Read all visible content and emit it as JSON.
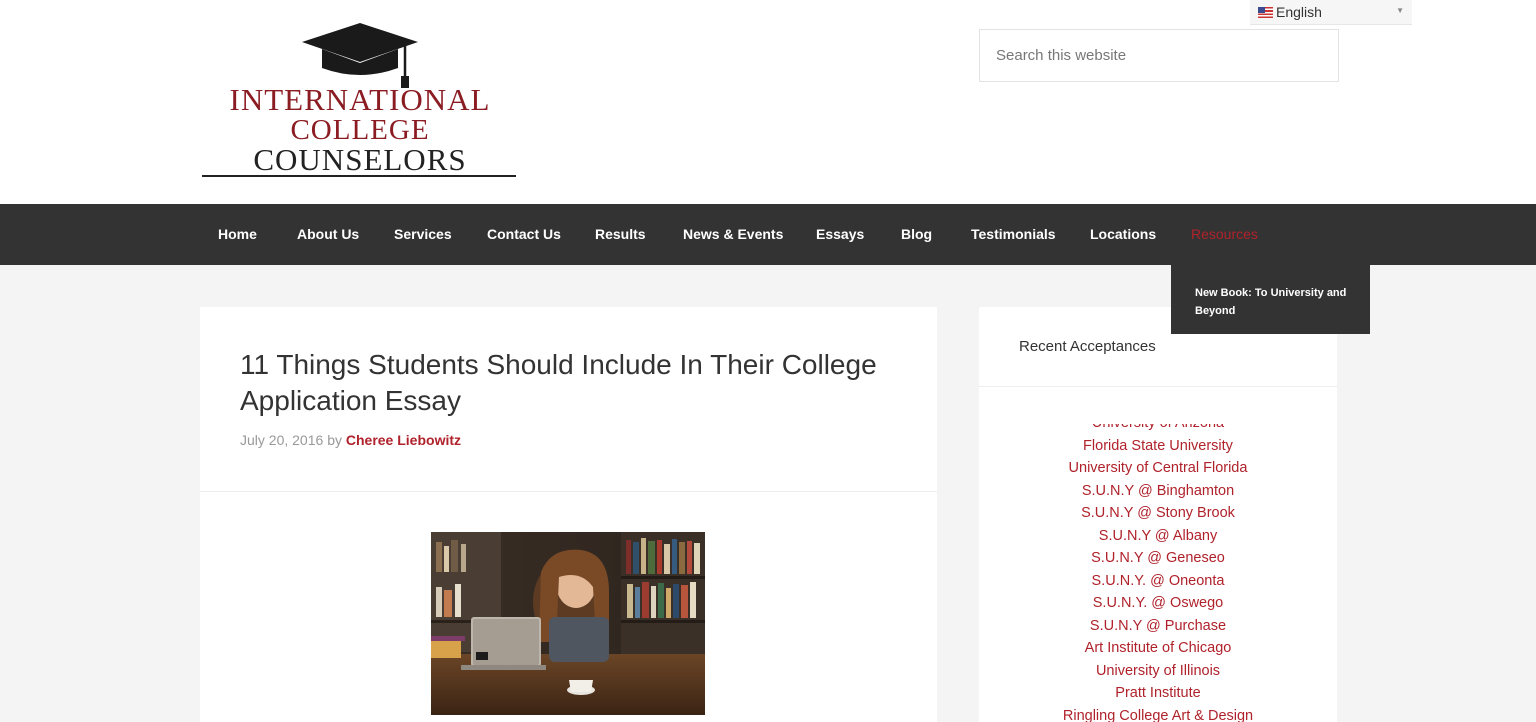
{
  "brand": {
    "logo_line1": "INTERNATIONAL",
    "logo_line2": "COLLEGE",
    "logo_line3": "COUNSELORS",
    "colors": {
      "accent": "#b0222b",
      "nav_bg": "#333333",
      "page_bg": "#f4f4f4"
    }
  },
  "language": {
    "label": "English",
    "flag_icon": "us-flag-icon"
  },
  "search": {
    "placeholder": "Search this website"
  },
  "nav": {
    "items": [
      "Home",
      "About Us",
      "Services",
      "Contact Us",
      "Results",
      "News & Events",
      "Essays",
      "Blog",
      "Testimonials",
      "Locations",
      "Resources"
    ],
    "active": "Resources",
    "submenu": [
      "New Book: To University and Beyond"
    ]
  },
  "post": {
    "title": "11 Things Students Should Include In Their College Application Essay",
    "date": "July 20, 2016",
    "by": "by",
    "author": "Cheree Liebowitz"
  },
  "sidebar": {
    "title": "Recent Acceptances",
    "acceptances": [
      "University of Arizona",
      "Florida State University",
      "University of Central Florida",
      "S.U.N.Y @ Binghamton",
      "S.U.N.Y @ Stony Brook",
      "S.U.N.Y @ Albany",
      "S.U.N.Y @ Geneseo",
      "S.U.N.Y. @ Oneonta",
      "S.U.N.Y. @ Oswego",
      "S.U.N.Y @ Purchase",
      "Art Institute of Chicago",
      "University of Illinois",
      "Pratt Institute",
      "Ringling College Art & Design"
    ]
  }
}
